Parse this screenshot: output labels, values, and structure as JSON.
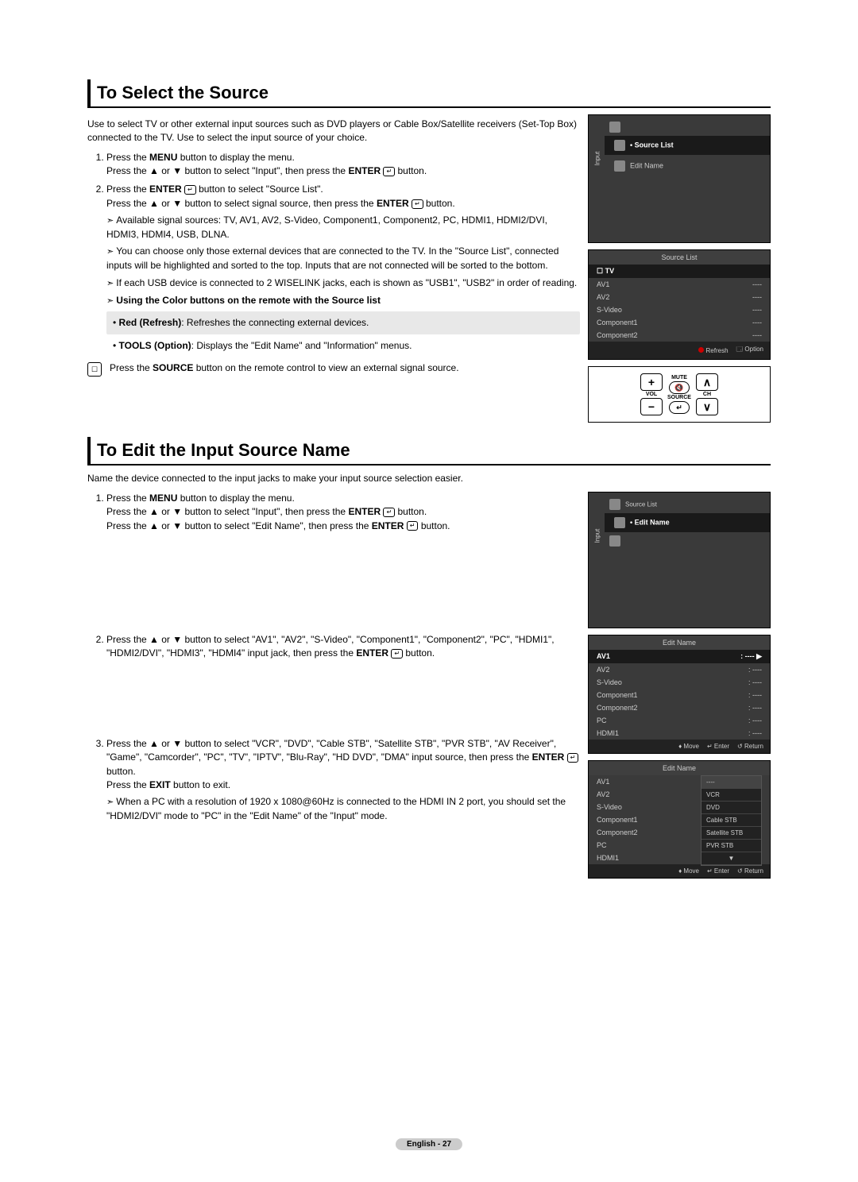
{
  "s1": {
    "title": "To Select the Source",
    "intro": "Use to select TV or other external input sources such as DVD players or Cable Box/Satellite receivers (Set-Top Box) connected to the TV. Use to select the input source of your choice.",
    "step1a": "Press the ",
    "step1b": " button to display the menu.",
    "menu": "MENU",
    "step1c": "Press the ▲ or ▼ button to select \"Input\", then press the ",
    "step1d": " button.",
    "enter": "ENTER",
    "step2a": "Press the ",
    "step2b": " button to select \"Source List\".",
    "step2c": "Press the ▲ or ▼ button to select signal source, then press the ",
    "step2d": " button.",
    "sub1": "Available signal sources: TV, AV1, AV2, S-Video, Component1, Component2, PC, HDMI1, HDMI2/DVI, HDMI3, HDMI4, USB, DLNA.",
    "sub2": "You can choose only those external devices that are connected to the TV. In the \"Source List\", connected inputs will be highlighted and sorted to the top. Inputs that are not connected will be sorted to the bottom.",
    "sub3": "If each USB device is connected to 2 WISELINK jacks, each is shown as \"USB1\", \"USB2\" in order of reading.",
    "sub4": "Using the Color buttons on the remote with the Source list",
    "bul1a": "Red (Refresh)",
    "bul1b": ": Refreshes the connecting external devices.",
    "bul2a": "TOOLS (Option)",
    "bul2b": ": Displays the \"Edit Name\" and \"Information\" menus.",
    "note": "Press the ",
    "noteB": "SOURCE",
    "note2": " button on the remote control to view an external signal source."
  },
  "osd1": {
    "input": "Input",
    "source_list": "Source List",
    "edit_name": "Edit Name",
    "tv": "TV",
    "items": [
      "AV1",
      "AV2",
      "S-Video",
      "Component1",
      "Component2"
    ],
    "refresh": "Refresh",
    "option": "Option"
  },
  "remote": {
    "mute": "MUTE",
    "vol": "VOL",
    "source": "SOURCE",
    "ch": "CH"
  },
  "s2": {
    "title": "To Edit the Input Source Name",
    "intro": "Name the device connected to the input jacks to make your input source selection easier.",
    "step1a": "Press the ",
    "step1b": " button to display the menu.",
    "step1c": "Press the ▲ or ▼ button to select \"Input\", then press the ",
    "step1d": " button.",
    "step1e": "Press the ▲ or ▼ button to select \"Edit Name\", then press the ",
    "step1f": " button.",
    "step2a": "Press the ▲ or ▼ button to select \"AV1\", \"AV2\", \"S-Video\", \"Component1\", \"Component2\", \"PC\", \"HDMI1\", \"HDMI2/DVI\", \"HDMI3\", \"HDMI4\" input jack, then press the ",
    "step2b": " button.",
    "step3a": "Press the ▲ or ▼ button to select \"VCR\", \"DVD\", \"Cable STB\", \"Satellite STB\", \"PVR STB\", \"AV Receiver\", \"Game\", \"Camcorder\", \"PC\", \"TV\", \"IPTV\", \"Blu-Ray\", \"HD DVD\", \"DMA\" input source, then press the ",
    "step3b": " button.",
    "step3c": "Press the ",
    "exit": "EXIT",
    "step3d": " button to exit.",
    "sub1": "When a PC with a resolution of 1920 x 1080@60Hz is connected to the HDMI IN 2 port, you should set the \"HDMI2/DVI\" mode to \"PC\" in the \"Edit Name\" of the \"Input\" mode."
  },
  "osd2": {
    "title": "Edit Name",
    "items": [
      "AV1",
      "AV2",
      "S-Video",
      "Component1",
      "Component2",
      "PC",
      "HDMI1"
    ],
    "move": "Move",
    "enter": "Enter",
    "return": "Return"
  },
  "osd3": {
    "title": "Edit Name",
    "items": [
      "AV1",
      "AV2",
      "S-Video",
      "Component1",
      "Component2",
      "PC",
      "HDMI1"
    ],
    "popup": [
      "----",
      "VCR",
      "DVD",
      "Cable STB",
      "Satellite STB",
      "PVR STB"
    ],
    "move": "Move",
    "enter": "Enter",
    "return": "Return"
  },
  "footer": "English - 27"
}
